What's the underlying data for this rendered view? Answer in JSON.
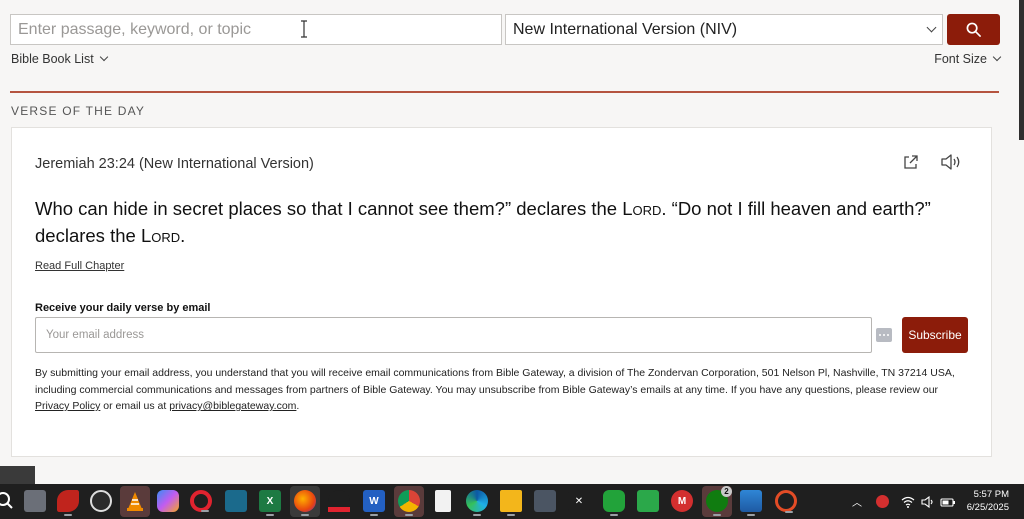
{
  "search": {
    "placeholder": "Enter passage, keyword, or topic",
    "version_label": "New International Version (NIV)"
  },
  "nav": {
    "book_list_label": "Bible Book List",
    "font_size_label": "Font Size"
  },
  "votd": {
    "heading": "VERSE OF THE DAY",
    "reference": "Jeremiah 23:24 (New International Version)",
    "verse_part1": "Who can hide in secret places so that I cannot see them?” declares the ",
    "lord": "Lord",
    "verse_part2": ". “Do not I fill heaven and earth?” declares the ",
    "verse_part3": ".",
    "read_link": "Read Full Chapter"
  },
  "subscribe": {
    "label": "Receive your daily verse by email",
    "placeholder": "Your email address",
    "button": "Subscribe",
    "disclaimer_part1": "By submitting your email address, you understand that you will receive email communications from Bible Gateway, a division of The Zondervan Corporation, 501 Nelson Pl, Nashville, TN 37214 USA, including commercial communications and messages from partners of Bible Gateway. You may unsubscribe from Bible Gateway’s emails at any time. If you have any questions, please review our ",
    "privacy_link": "Privacy Policy",
    "disclaimer_part2": " or email us at ",
    "email_link": "privacy@biblegateway.com",
    "disclaimer_part3": "."
  },
  "taskbar": {
    "badge_count": "2",
    "clock_time": "5:57 PM",
    "clock_date": "6/25/2025"
  },
  "colors": {
    "accent": "#8c1c0a",
    "divider": "#b5543f",
    "background": "#f7f6f5"
  }
}
